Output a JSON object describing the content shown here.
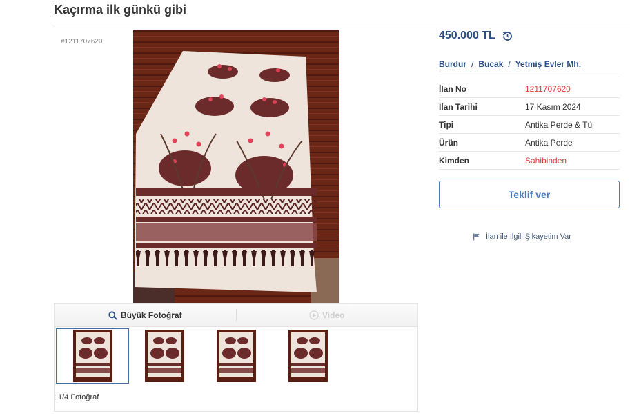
{
  "page": {
    "title": "Kaçırma ilk günkü gibi",
    "listing_id_tag": "#1211707620"
  },
  "gallery": {
    "main_photo_icon": "carpet-photo",
    "toolbar": {
      "big_photo_label": "Büyük Fotoğraf",
      "video_label": "Video"
    },
    "thumbnails": [
      {
        "label": "thumbnail-1",
        "selected": true
      },
      {
        "label": "thumbnail-2",
        "selected": false
      },
      {
        "label": "thumbnail-3",
        "selected": false
      },
      {
        "label": "thumbnail-4",
        "selected": false
      }
    ],
    "photo_count": "1/4 Fotoğraf"
  },
  "price": {
    "value": "450.000 TL",
    "history_icon": "history-icon"
  },
  "location": {
    "city": "Burdur",
    "district": "Bucak",
    "neighborhood": "Yetmiş Evler Mh.",
    "separator": "/"
  },
  "details": [
    {
      "key": "İlan No",
      "value": "1211707620",
      "highlight": true
    },
    {
      "key": "İlan Tarihi",
      "value": "17 Kasım 2024",
      "highlight": false
    },
    {
      "key": "Tipi",
      "value": "Antika Perde & Tül",
      "highlight": false
    },
    {
      "key": "Ürün",
      "value": "Antika Perde",
      "highlight": false
    },
    {
      "key": "Kimden",
      "value": "Sahibinden",
      "highlight": true
    }
  ],
  "actions": {
    "offer_label": "Teklif ver",
    "report_label": "İlan ile İlgili Şikayetim Var"
  },
  "colors": {
    "brand_blue": "#2a4d83",
    "accent_red": "#e23c3c",
    "button_blue": "#4a79c0"
  }
}
